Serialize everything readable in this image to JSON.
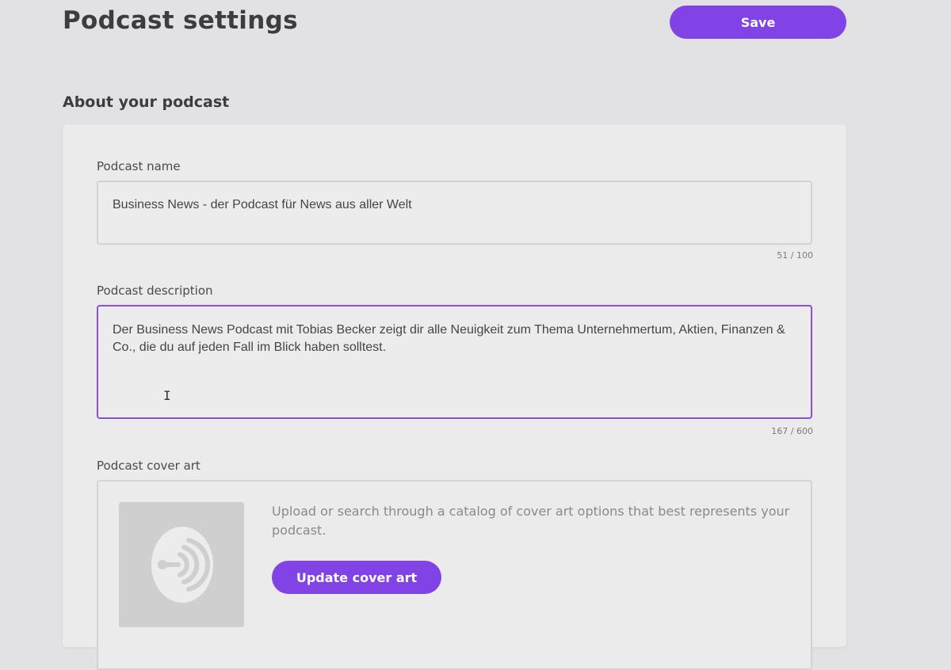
{
  "header": {
    "title": "Podcast settings",
    "save_label": "Save"
  },
  "section": {
    "heading": "About your podcast"
  },
  "fields": {
    "name": {
      "label": "Podcast name",
      "value": "Business News - der Podcast für News aus aller Welt",
      "counter": "51 / 100"
    },
    "description": {
      "label": "Podcast description",
      "value": "Der Business News Podcast mit Tobias Becker zeigt dir alle Neuigkeit zum Thema Unternehmertum, Aktien, Finanzen & Co., die du auf jeden Fall im Blick haben solltest.",
      "counter": "167 / 600",
      "cursor": "I"
    },
    "cover": {
      "label": "Podcast cover art",
      "help": "Upload or search through a catalog of cover art options that best represents your podcast.",
      "button_label": "Update cover art",
      "placeholder_icon": "podcast-signal-icon"
    }
  },
  "colors": {
    "accent": "#8143e6",
    "focus_border": "#8b4fdc",
    "background": "#e2e2e4",
    "card": "#ebebeb"
  }
}
